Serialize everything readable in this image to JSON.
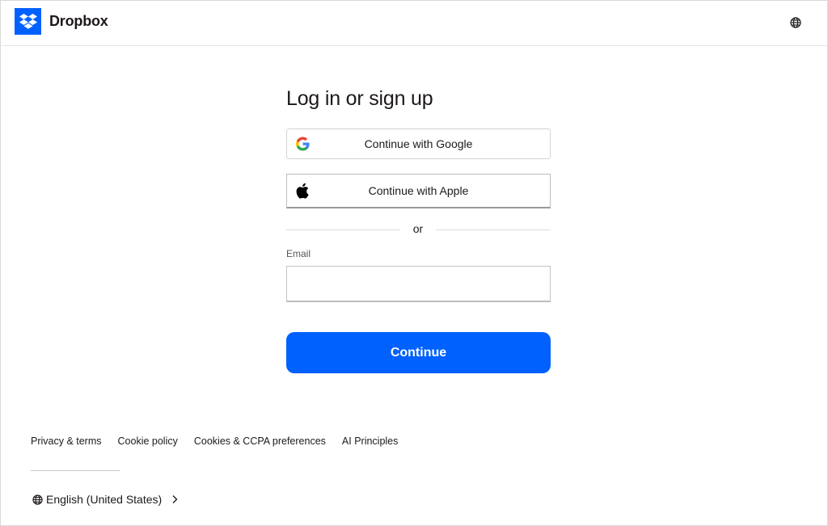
{
  "header": {
    "brand": "Dropbox",
    "logo_icon": "dropbox-logo-icon",
    "language_icon": "globe-icon",
    "brand_color": "#0061fe"
  },
  "main": {
    "title": "Log in or sign up",
    "google_button": "Continue with Google",
    "apple_button": "Continue with Apple",
    "divider_text": "or",
    "email_label": "Email",
    "email_value": "",
    "continue_button": "Continue"
  },
  "footer": {
    "links": [
      "Privacy & terms",
      "Cookie policy",
      "Cookies & CCPA preferences",
      "AI Principles"
    ],
    "language": "English (United States)",
    "language_icon": "globe-icon",
    "language_chevron": "chevron-right-icon"
  }
}
